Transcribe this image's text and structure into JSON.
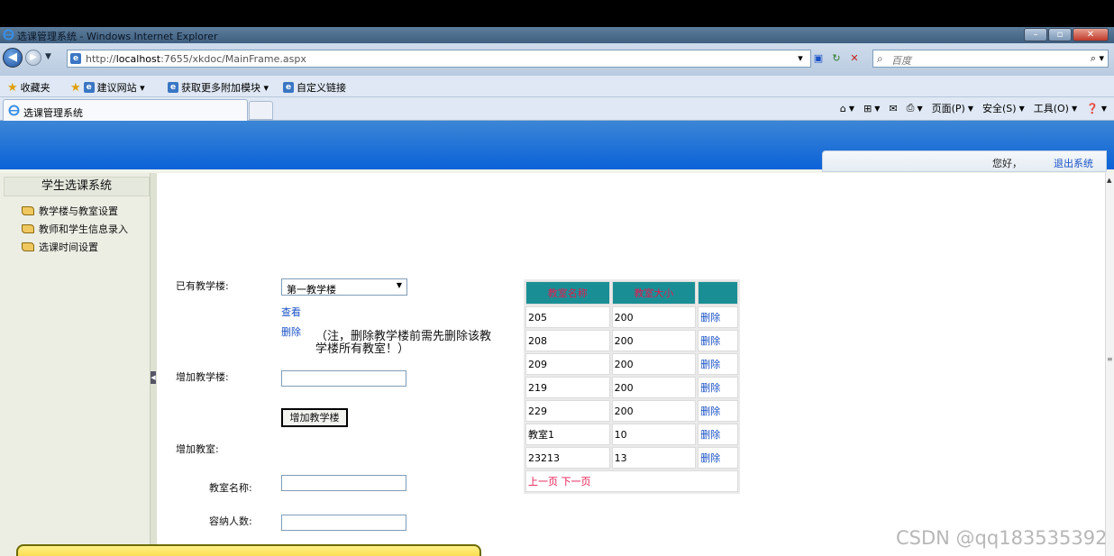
{
  "window": {
    "title": "选课管理系统 - Windows Internet Explorer"
  },
  "address": {
    "url_prefix": "http://",
    "url_host": "localhost",
    "url_rest": ":7655/xkdoc/MainFrame.aspx",
    "search_placeholder": "百度"
  },
  "favorites": {
    "items": [
      "收藏夹",
      "建议网站 ▾",
      "获取更多附加模块 ▾",
      "自定义链接"
    ]
  },
  "tabs": [
    {
      "label": "选课管理系统"
    }
  ],
  "commands": [
    "页面(P)",
    "安全(S)",
    "工具(O)"
  ],
  "header": {
    "hello": "您好，",
    "logout": "退出系统"
  },
  "sidebar": {
    "title": "学生选课系统",
    "items": [
      {
        "label": "教学楼与教室设置"
      },
      {
        "label": "教师和学生信息录入"
      },
      {
        "label": "选课时间设置"
      }
    ]
  },
  "form": {
    "existing_label": "已有教学楼:",
    "selected_building": "第一教学楼",
    "view_link": "查看",
    "delete_link": "删除",
    "note": "（注，删除教学楼前需先删除该教学楼所有教室！）",
    "add_building_label": "增加教学楼:",
    "add_building_button": "增加教学楼",
    "add_room_label": "增加教室:",
    "room_name_label": "教室名称:",
    "capacity_label": "容纳人数:"
  },
  "rooms_table": {
    "headers": [
      "教室名称",
      "教室大小",
      ""
    ],
    "rows": [
      {
        "name": "205",
        "size": "200",
        "action": "删除"
      },
      {
        "name": "208",
        "size": "200",
        "action": "删除"
      },
      {
        "name": "209",
        "size": "200",
        "action": "删除"
      },
      {
        "name": "219",
        "size": "200",
        "action": "删除"
      },
      {
        "name": "229",
        "size": "200",
        "action": "删除"
      },
      {
        "name": "教室1",
        "size": "10",
        "action": "删除"
      },
      {
        "name": "23213",
        "size": "13",
        "action": "删除"
      }
    ],
    "pager_prev": "上一页",
    "pager_next": "下一页"
  },
  "watermark": "CSDN @qq183535392",
  "colors": {
    "header_blue": "#0b62d8",
    "table_header_bg": "#198f95",
    "table_header_text": "#e31b52",
    "link_blue": "#1a52c6"
  }
}
